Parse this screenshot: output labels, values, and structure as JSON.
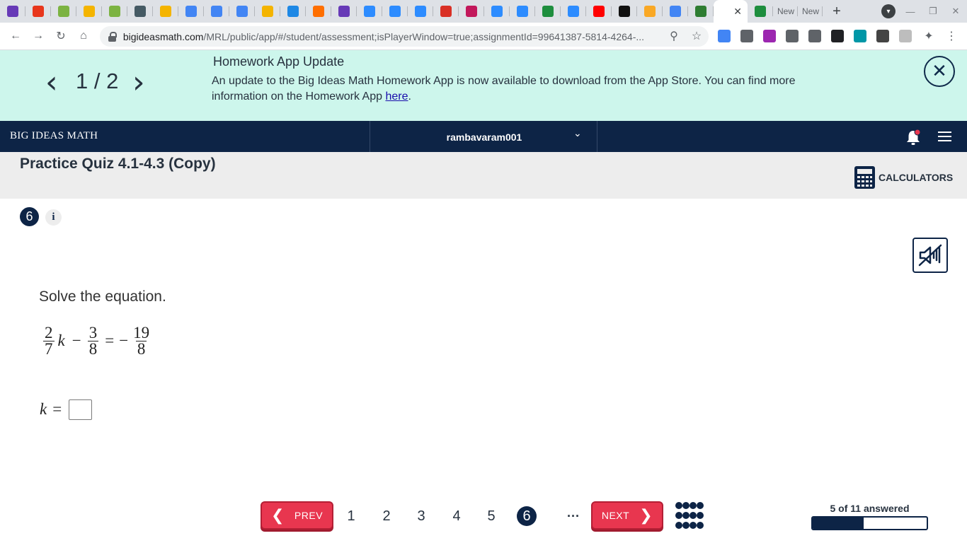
{
  "browser": {
    "tab_favicons": [
      {
        "name": "forms-icon",
        "color": "#673ab7"
      },
      {
        "name": "adobe-icon",
        "color": "#e8361c"
      },
      {
        "name": "ixl-icon",
        "color": "#7cb342"
      },
      {
        "name": "slides-icon",
        "color": "#f4b400"
      },
      {
        "name": "ixl-icon",
        "color": "#7cb342"
      },
      {
        "name": "layers-icon",
        "color": "#455a64"
      },
      {
        "name": "slides-icon",
        "color": "#f4b400"
      },
      {
        "name": "docs-icon",
        "color": "#4285f4"
      },
      {
        "name": "docs-icon",
        "color": "#4285f4"
      },
      {
        "name": "docs-icon",
        "color": "#4285f4"
      },
      {
        "name": "slides-icon",
        "color": "#f4b400"
      },
      {
        "name": "g-app-icon",
        "color": "#1e88e5"
      },
      {
        "name": "f-app-icon",
        "color": "#ff6f00"
      },
      {
        "name": "forms-icon",
        "color": "#673ab7"
      },
      {
        "name": "zoom-icon",
        "color": "#2d8cff"
      },
      {
        "name": "zoom-icon",
        "color": "#2d8cff"
      },
      {
        "name": "zoom-icon",
        "color": "#2d8cff"
      },
      {
        "name": "gmail-icon",
        "color": "#d93025"
      },
      {
        "name": "pinwheel-icon",
        "color": "#c2185b"
      },
      {
        "name": "zoom-icon",
        "color": "#2d8cff"
      },
      {
        "name": "zoom-icon",
        "color": "#2d8cff"
      },
      {
        "name": "classroom-icon",
        "color": "#1e8e3e"
      },
      {
        "name": "zoom-icon",
        "color": "#2d8cff"
      },
      {
        "name": "youtube-icon",
        "color": "#ff0000"
      },
      {
        "name": "b-app-icon",
        "color": "#111111"
      },
      {
        "name": "pencil-app-icon",
        "color": "#f9a825"
      },
      {
        "name": "google-icon",
        "color": "#4285f4"
      },
      {
        "name": "diamond-app-icon",
        "color": "#2e7d32"
      }
    ],
    "active_tab_close": "✕",
    "after_tabs": [
      {
        "name": "classroom-icon",
        "color": "#1e8e3e"
      }
    ],
    "text_tabs": [
      "New",
      "New"
    ],
    "new_tab": "+",
    "url_host": "bigideasmath.com",
    "url_path": "/MRL/public/app/#/student/assessment;isPlayerWindow=true;assignmentId=99641387-5814-4264-...",
    "extensions": [
      {
        "name": "translate-icon",
        "color": "#4285f4"
      },
      {
        "name": "ext-shield-icon",
        "color": "#5f6368"
      },
      {
        "name": "ext-puzzle-icon",
        "color": "#9c27b0"
      },
      {
        "name": "ext-pen-icon",
        "color": "#5f6368"
      },
      {
        "name": "ext-layers-icon",
        "color": "#5f6368"
      },
      {
        "name": "ext-bot-icon",
        "color": "#202124"
      },
      {
        "name": "ext-circle-icon",
        "color": "#0097a7"
      },
      {
        "name": "ext-l-icon",
        "color": "#444444"
      },
      {
        "name": "ext-b-icon",
        "color": "#bdbdbd"
      }
    ]
  },
  "banner": {
    "prev_arrow": "‹",
    "next_arrow": "›",
    "counter": "1 / 2",
    "title": "Homework App Update",
    "text": "An update to the Big Ideas Math Homework App is now available to download from the App Store. You can find more information on the Homework App ",
    "link_text": "here",
    "link_suffix": ".",
    "close": "✕"
  },
  "appbar": {
    "brand": "BIG IDEAS MATH",
    "username": "rambavaram001",
    "caret": "⌄"
  },
  "quiz": {
    "title": "Practice Quiz 4.1-4.3 (Copy)",
    "calculators_label": "CALCULATORS"
  },
  "question": {
    "number": "6",
    "info": "i",
    "prompt": "Solve the equation.",
    "equation": {
      "frac1_num": "2",
      "frac1_den": "7",
      "var": "k",
      "minus": "−",
      "frac2_num": "3",
      "frac2_den": "8",
      "equals": "=",
      "neg": "−",
      "frac3_num": "19",
      "frac3_den": "8"
    },
    "answer_var": "k",
    "answer_equals": "=",
    "answer_value": ""
  },
  "nav": {
    "prev_label": "PREV",
    "next_label": "NEXT",
    "prev_chev": "❮",
    "next_chev": "❯",
    "pages": [
      "1",
      "2",
      "3",
      "4",
      "5",
      "6"
    ],
    "current_page": "6",
    "ellipsis": "···",
    "progress_label": "5 of 11 answered",
    "progress_fraction": 0.45
  }
}
